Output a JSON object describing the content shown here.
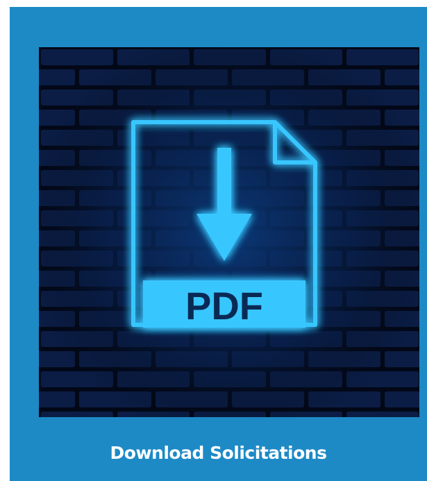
{
  "tile": {
    "caption": "Download Solicitations",
    "icon": {
      "name": "pdf-download-icon",
      "label": "PDF"
    }
  },
  "colors": {
    "card_background": "#1d8ac6",
    "image_background": "#030817",
    "brick": "#0b1d45",
    "neon": "#37c6ff",
    "caption_text": "#ffffff"
  }
}
